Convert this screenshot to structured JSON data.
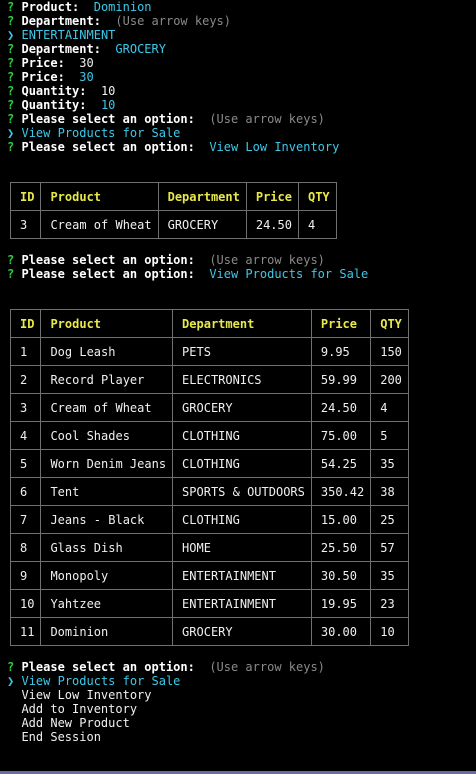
{
  "colors": {
    "background": "#000000",
    "prompt_mark": "#2ecc40",
    "answer": "#3ec8e8",
    "hint": "#8a8a8a",
    "table_header": "#e8e84a",
    "border": "#707070"
  },
  "symbols": {
    "question": "?",
    "pointer": "❯"
  },
  "top_lines": [
    {
      "type": "answered",
      "label": "Product:",
      "value": "Dominion"
    },
    {
      "type": "hint",
      "label": "Department:",
      "value": "(Use arrow keys)"
    },
    {
      "type": "pointer",
      "value": "ENTERTAINMENT"
    },
    {
      "type": "answered",
      "label": "Department:",
      "value": "GROCERY"
    },
    {
      "type": "input",
      "label": "Price:",
      "value": "30"
    },
    {
      "type": "answered",
      "label": "Price:",
      "value": "30"
    },
    {
      "type": "input",
      "label": "Quantity:",
      "value": "10"
    },
    {
      "type": "answered",
      "label": "Quantity:",
      "value": "10"
    },
    {
      "type": "hint",
      "label": "Please select an option:",
      "value": "(Use arrow keys)"
    },
    {
      "type": "pointer",
      "value": "View Products for Sale"
    },
    {
      "type": "answered",
      "label": "Please select an option:",
      "value": "View Low Inventory"
    }
  ],
  "low_inventory_table": {
    "headers": [
      "ID",
      "Product",
      "Department",
      "Price",
      "QTY"
    ],
    "rows": [
      [
        "3",
        "Cream of Wheat",
        "GROCERY",
        "24.50",
        "4"
      ]
    ]
  },
  "middle_lines": [
    {
      "type": "hint",
      "label": "Please select an option:",
      "value": "(Use arrow keys)"
    },
    {
      "type": "answered",
      "label": "Please select an option:",
      "value": "View Products for Sale"
    }
  ],
  "products_table": {
    "headers": [
      "ID",
      "Product",
      "Department",
      "Price",
      "QTY"
    ],
    "rows": [
      [
        "1",
        "Dog Leash",
        "PETS",
        "9.95",
        "150"
      ],
      [
        "2",
        "Record Player",
        "ELECTRONICS",
        "59.99",
        "200"
      ],
      [
        "3",
        "Cream of Wheat",
        "GROCERY",
        "24.50",
        "4"
      ],
      [
        "4",
        "Cool Shades",
        "CLOTHING",
        "75.00",
        "5"
      ],
      [
        "5",
        "Worn Denim Jeans",
        "CLOTHING",
        "54.25",
        "35"
      ],
      [
        "6",
        "Tent",
        "SPORTS & OUTDOORS",
        "350.42",
        "38"
      ],
      [
        "7",
        "Jeans - Black",
        "CLOTHING",
        "15.00",
        "25"
      ],
      [
        "8",
        "Glass Dish",
        "HOME",
        "25.50",
        "57"
      ],
      [
        "9",
        "Monopoly",
        "ENTERTAINMENT",
        "30.50",
        "35"
      ],
      [
        "10",
        "Yahtzee",
        "ENTERTAINMENT",
        "19.95",
        "23"
      ],
      [
        "11",
        "Dominion",
        "GROCERY",
        "30.00",
        "10"
      ]
    ]
  },
  "menu": {
    "label": "Please select an option:",
    "hint": "(Use arrow keys)",
    "options": [
      "View Products for Sale",
      "View Low Inventory",
      "Add to Inventory",
      "Add New Product",
      "End Session"
    ],
    "selected_index": 0
  }
}
